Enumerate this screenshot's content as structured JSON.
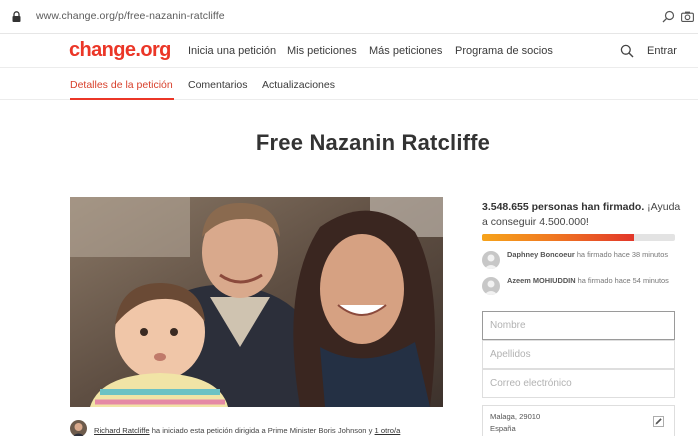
{
  "browser": {
    "url": "www.change.org/p/free-nazanin-ratcliffe"
  },
  "header": {
    "logo": "change.org",
    "nav": [
      "Inicia una petición",
      "Mis peticiones",
      "Más peticiones",
      "Programa de socios"
    ],
    "login": "Entrar"
  },
  "subtabs": {
    "details": "Detalles de la petición",
    "comments": "Comentarios",
    "updates": "Actualizaciones"
  },
  "petition": {
    "title": "Free Nazanin Ratcliffe",
    "starter_name": "Richard Ratcliffe",
    "starter_text": " ha iniciado esta petición dirigida a Prime Minister Boris Johnson y ",
    "starter_others": "1 otro/a"
  },
  "signatures": {
    "count_text": "3.548.655 personas han firmado.",
    "goal_text": " ¡Ayuda a conseguir 4.500.000!",
    "progress_fraction": 0.79
  },
  "recent_signers": [
    {
      "name": "Daphney Boncoeur",
      "text": " ha firmado hace 38 minutos"
    },
    {
      "name": "Azeem MOHIUDDIN",
      "text": " ha firmado hace 54 minutos"
    }
  ],
  "form": {
    "first_name_placeholder": "Nombre",
    "last_name_placeholder": "Apellidos",
    "email_placeholder": "Correo electrónico",
    "location_line1": "Malaga, 29010",
    "location_line2": "España"
  },
  "colors": {
    "brand": "#eb3627",
    "progress_start": "#f6a31b",
    "progress_end": "#e2372a"
  },
  "icons": [
    "lock-icon",
    "find-icon",
    "camera-icon",
    "search-icon",
    "user-avatar-icon",
    "edit-icon"
  ]
}
